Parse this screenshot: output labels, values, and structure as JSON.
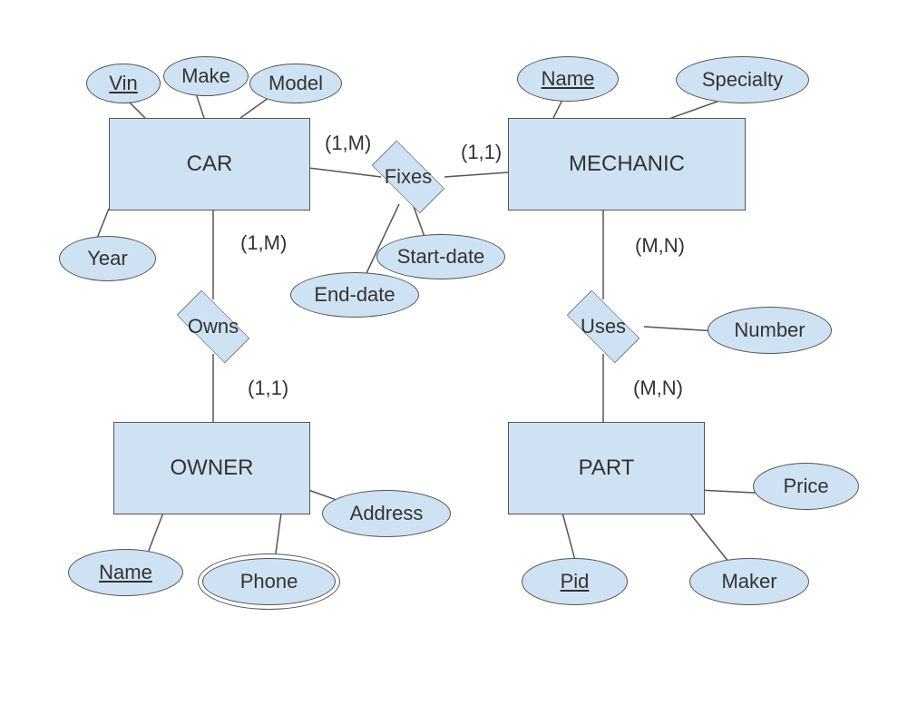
{
  "entities": {
    "car": "CAR",
    "mechanic": "MECHANIC",
    "owner": "OWNER",
    "part": "PART"
  },
  "relationships": {
    "fixes": "Fixes",
    "owns": "Owns",
    "uses": "Uses"
  },
  "attributes": {
    "vin": "Vin",
    "make": "Make",
    "model": "Model",
    "year": "Year",
    "mechName": "Name",
    "specialty": "Specialty",
    "startDate": "Start-date",
    "endDate": "End-date",
    "number": "Number",
    "ownerName": "Name",
    "phone": "Phone",
    "address": "Address",
    "pid": "Pid",
    "maker": "Maker",
    "price": "Price"
  },
  "cardinalities": {
    "carFixes": "(1,M)",
    "mechFixes": "(1,1)",
    "carOwns": "(1,M)",
    "ownerOwns": "(1,1)",
    "mechUses": "(M,N)",
    "partUses": "(M,N)"
  }
}
